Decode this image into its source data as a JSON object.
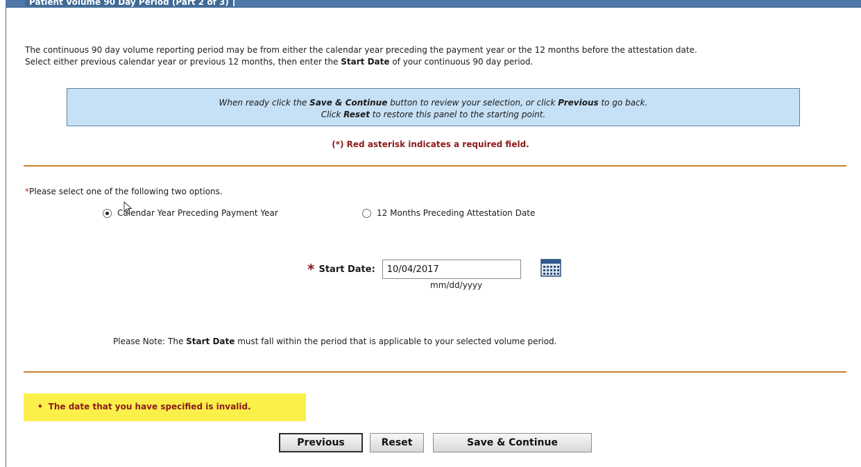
{
  "panel": {
    "title": "Patient Volume 90 Day Period (Part 2 of 3)"
  },
  "intro": {
    "line1": "The continuous 90 day volume reporting period may be from either the calendar year preceding the payment year or the 12 months before the attestation date.",
    "line2_pre": "Select either previous calendar year or previous 12 months, then enter the ",
    "line2_bold": "Start Date",
    "line2_post": " of your continuous 90 day period."
  },
  "info_box": {
    "l1_a": "When ready click the ",
    "l1_b": "Save & Continue",
    "l1_c": " button to review your selection, or click ",
    "l1_d": "Previous",
    "l1_e": " to go back.",
    "l2_a": "Click ",
    "l2_b": "Reset",
    "l2_c": " to restore this panel to the starting point."
  },
  "required_note": "(*) Red asterisk indicates a required field.",
  "options": {
    "asterisk": "*",
    "prompt": "Please select one of the following two options.",
    "option1": "Calendar Year Preceding Payment Year",
    "option2": "12 Months Preceding Attestation Date",
    "selected": "option1"
  },
  "start_date": {
    "asterisk": "*",
    "label": "Start Date:",
    "value": "10/04/2017",
    "format": "mm/dd/yyyy"
  },
  "note": {
    "pre": "Please Note: The ",
    "bold": "Start Date",
    "post": " must fall within the period that is applicable to your selected volume period."
  },
  "error": {
    "bullet": "•",
    "message": "The date that you have specified is invalid."
  },
  "buttons": {
    "previous": "Previous",
    "reset": "Reset",
    "save_continue": "Save & Continue"
  },
  "colors": {
    "title_bar": "#4e79a8",
    "info_box": "#c6e0f5",
    "divider": "#c9802a",
    "error_bg": "#fbf04a",
    "required_red": "#8b1a1a"
  }
}
